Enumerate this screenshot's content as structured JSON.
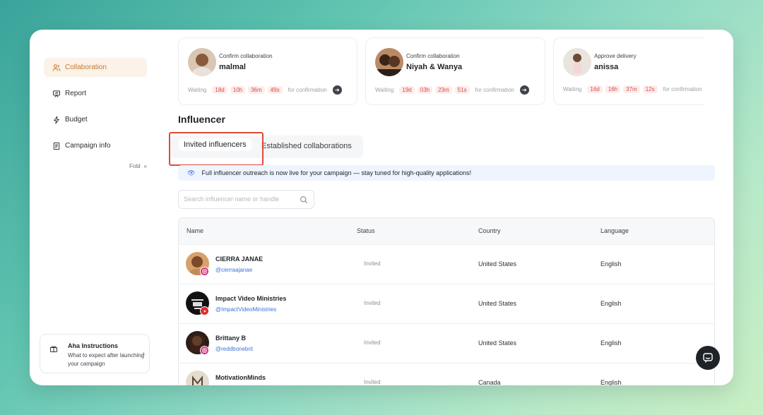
{
  "sidebar": {
    "items": [
      {
        "label": "Collaboration",
        "icon": "users-icon",
        "active": true
      },
      {
        "label": "Report",
        "icon": "presentation-icon",
        "active": false
      },
      {
        "label": "Budget",
        "icon": "lightning-icon",
        "active": false
      },
      {
        "label": "Campaign info",
        "icon": "document-icon",
        "active": false
      }
    ],
    "fold_label": "Fold",
    "fold_icon": "double-chevron-left-icon"
  },
  "aha": {
    "title": "Aha Instructions",
    "subtitle": "What to expect after launching your campaign",
    "icon": "gift-icon"
  },
  "cards": [
    {
      "type": "Confirm collaboration",
      "name": "malmal",
      "waiting": "Waiting",
      "d": "18d",
      "h": "10h",
      "m": "36m",
      "s": "49s",
      "suffix": "for confirmation"
    },
    {
      "type": "Confirm collaboration",
      "name": "Niyah & Wanya",
      "waiting": "Waiting",
      "d": "19d",
      "h": "03h",
      "m": "23m",
      "s": "51s",
      "suffix": "for confirmation"
    },
    {
      "type": "Approve delivery",
      "name": "anissa",
      "waiting": "Waiting",
      "d": "16d",
      "h": "16h",
      "m": "37m",
      "s": "12s",
      "suffix": "for confirmation"
    }
  ],
  "section": {
    "title": "Influencer"
  },
  "tabs": [
    {
      "label": "Invited influencers",
      "active": true
    },
    {
      "label": "Established collaborations",
      "active": false
    }
  ],
  "banner": {
    "text": "Full influencer outreach is now live for your campaign — stay tuned for high-quality applications!",
    "icon": "eye-icon"
  },
  "search": {
    "placeholder": "Search influencer name or handle",
    "icon": "search-icon"
  },
  "table": {
    "headers": [
      "Name",
      "Status",
      "Country",
      "Language"
    ],
    "rows": [
      {
        "name": "CIERRA JANAE",
        "handle": "@cierraajanae",
        "platform": "instagram",
        "status": "Invited",
        "country": "United States",
        "language": "English"
      },
      {
        "name": "Impact Video Ministries",
        "handle": "@ImpactVideoMinistries",
        "platform": "youtube",
        "status": "Invited",
        "country": "United States",
        "language": "English"
      },
      {
        "name": "Brittany B",
        "handle": "@reddbonebrit",
        "platform": "instagram",
        "status": "Invited",
        "country": "United States",
        "language": "English"
      },
      {
        "name": "MotivationMinds",
        "handle": "",
        "platform": "",
        "status": "Invited",
        "country": "Canada",
        "language": "English"
      }
    ]
  },
  "colors": {
    "accent": "#c87a2d",
    "timer_red": "#d54b4b",
    "highlight_red": "#e04a3a",
    "link_blue": "#3b73d8"
  }
}
